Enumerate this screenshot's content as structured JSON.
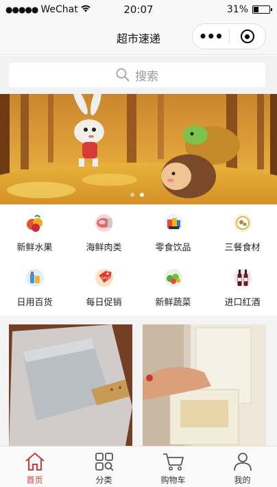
{
  "status_bar": {
    "signal_dots": "●●●●●",
    "carrier": "WeChat",
    "time": "20:07",
    "battery": "31%",
    "battery_level": 0.31
  },
  "nav": {
    "title": "超市速递",
    "more_icon": "more-dots-icon",
    "close_icon": "target-close-icon"
  },
  "search": {
    "placeholder": "搜索",
    "icon": "search-icon"
  },
  "banner": {
    "slide_count": 2,
    "active_index": 1
  },
  "categories": [
    {
      "label": "新鲜水果",
      "icon": "fruit-icon"
    },
    {
      "label": "海鲜肉类",
      "icon": "meat-icon"
    },
    {
      "label": "零食饮品",
      "icon": "snacks-icon"
    },
    {
      "label": "三餐食材",
      "icon": "meal-icon"
    },
    {
      "label": "日用百货",
      "icon": "daily-goods-icon"
    },
    {
      "label": "每日促销",
      "icon": "sale-tag-icon"
    },
    {
      "label": "新鲜蔬菜",
      "icon": "vegetable-icon"
    },
    {
      "label": "进口红酒",
      "icon": "wine-icon"
    }
  ],
  "tabs": [
    {
      "label": "首页",
      "icon": "home-icon",
      "active": true
    },
    {
      "label": "分类",
      "icon": "category-grid-icon",
      "active": false
    },
    {
      "label": "购物车",
      "icon": "cart-icon",
      "active": false
    },
    {
      "label": "我的",
      "icon": "user-icon",
      "active": false
    }
  ],
  "colors": {
    "accent": "#d33a2c",
    "tab_inactive": "#333333",
    "search_text": "#999999"
  }
}
